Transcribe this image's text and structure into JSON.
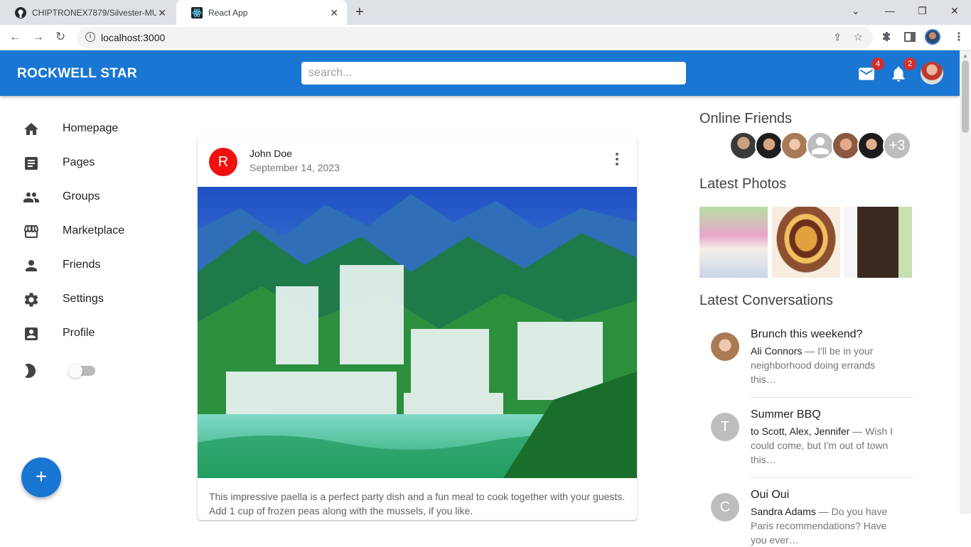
{
  "browser": {
    "tabs": [
      {
        "title": "CHIPTRONEX7879/Silvester-MUI"
      },
      {
        "title": "React App"
      }
    ],
    "url": "localhost:3000"
  },
  "appbar": {
    "brand": "ROCKWELL STAR",
    "search_placeholder": "search...",
    "mail_badge": "4",
    "notifications_badge": "2"
  },
  "sidebar": {
    "items": [
      {
        "label": "Homepage",
        "icon": "home-icon"
      },
      {
        "label": "Pages",
        "icon": "article-icon"
      },
      {
        "label": "Groups",
        "icon": "group-icon"
      },
      {
        "label": "Marketplace",
        "icon": "storefront-icon"
      },
      {
        "label": "Friends",
        "icon": "person-icon"
      },
      {
        "label": "Settings",
        "icon": "settings-icon"
      },
      {
        "label": "Profile",
        "icon": "account-box-icon"
      }
    ],
    "dark_mode_enabled": false
  },
  "post": {
    "avatar_letter": "R",
    "author": "John Doe",
    "date": "September 14, 2023",
    "text": "This impressive paella is a perfect party dish and a fun meal to cook together with your guests. Add 1 cup of frozen peas along with the mussels, if you like."
  },
  "rightbar": {
    "online_friends_title": "Online Friends",
    "more_friends": "+3",
    "latest_photos_title": "Latest Photos",
    "latest_conversations_title": "Latest Conversations",
    "conversations": [
      {
        "title": "Brunch this weekend?",
        "from": "Ali Connors",
        "preview": " — I'll be in your neighborhood doing errands this…",
        "initial": ""
      },
      {
        "title": "Summer BBQ",
        "from": "to Scott, Alex, Jennifer",
        "preview": " — Wish I could come, but I'm out of town this…",
        "initial": "T"
      },
      {
        "title": "Oui Oui",
        "from": "Sandra Adams",
        "preview": " — Do you have Paris recommendations? Have you ever…",
        "initial": "C"
      }
    ]
  },
  "colors": {
    "primary": "#1976d2",
    "badge": "#d32f2f",
    "avatar_red": "#f20f0f"
  }
}
